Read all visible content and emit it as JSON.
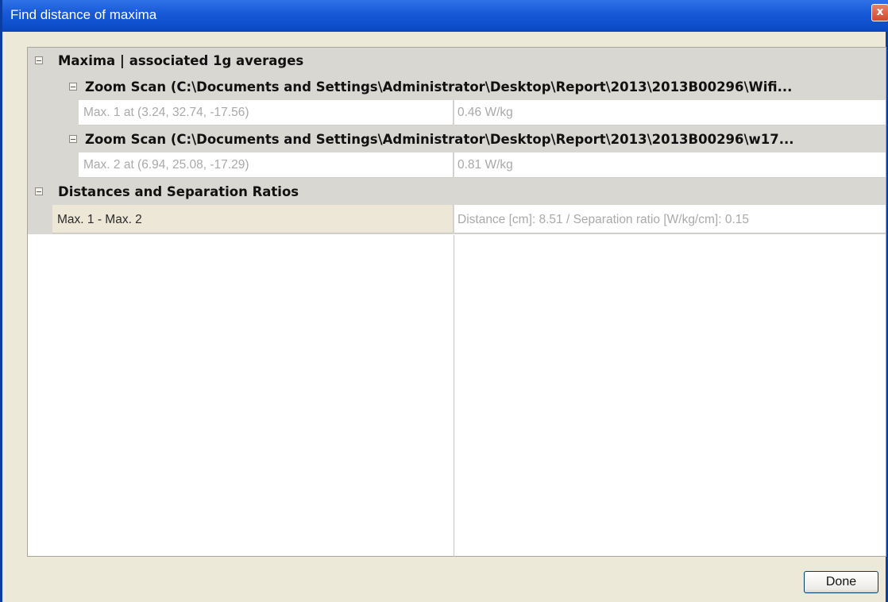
{
  "window": {
    "title": "Find distance of maxima",
    "close_label": "x"
  },
  "tree": {
    "categories": [
      {
        "label": "Maxima | associated 1g averages"
      },
      {
        "label": "Distances and Separation Ratios"
      }
    ],
    "zoom_scans": [
      {
        "label": "Zoom Scan (C:\\Documents and Settings\\Administrator\\Desktop\\Report\\2013\\2013B00296\\Wifi...",
        "max_name": "Max. 1 at (3.24, 32.74, -17.56)",
        "max_value": "0.46 W/kg"
      },
      {
        "label": "Zoom Scan (C:\\Documents and Settings\\Administrator\\Desktop\\Report\\2013\\2013B00296\\w17...",
        "max_name": "Max. 2 at (6.94, 25.08, -17.29)",
        "max_value": "0.81 W/kg"
      }
    ],
    "distances": [
      {
        "name": "Max. 1 - Max. 2",
        "value": "Distance [cm]: 8.51 / Separation ratio [W/kg/cm]: 0.15"
      }
    ]
  },
  "footer": {
    "done_label": "Done"
  },
  "colors": {
    "titlebar": "#0d4fcb",
    "category_bg": "#d9d7d1",
    "window_bg": "#ece9d8",
    "selected_row_bg": "#ece7d6"
  }
}
